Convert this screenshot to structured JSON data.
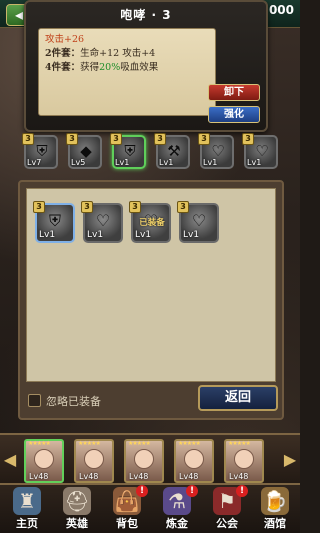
{
  "header": {
    "currency_value": "000"
  },
  "popup": {
    "title": "咆哮 · 3",
    "effects": {
      "attack": "攻击+26",
      "set2_label": "2件套：",
      "set2_text": "生命+12 攻击+4",
      "set4_label": "4件套：",
      "set4_prefix": "获得",
      "set4_pct": "20%",
      "set4_suffix": "吸血效果"
    },
    "buttons": {
      "unequip": "卸下",
      "enhance": "强化"
    }
  },
  "equipped": [
    {
      "badge": "3",
      "icon": "shield-icon",
      "level": "Lv7"
    },
    {
      "badge": "3",
      "icon": "diamond-icon",
      "level": "Lv5"
    },
    {
      "badge": "3",
      "icon": "shield-icon",
      "level": "Lv1"
    },
    {
      "badge": "3",
      "icon": "axe-icon",
      "level": "Lv1"
    },
    {
      "badge": "3",
      "icon": "heart-icon",
      "level": "Lv1"
    },
    {
      "badge": "3",
      "icon": "heart-icon",
      "level": "Lv1"
    }
  ],
  "inventory": [
    {
      "badge": "3",
      "icon": "shield-icon",
      "level": "Lv1",
      "tag": ""
    },
    {
      "badge": "3",
      "icon": "heart-icon",
      "level": "Lv1",
      "tag": ""
    },
    {
      "badge": "3",
      "icon": "heart-icon",
      "level": "Lv1",
      "tag": "已装备"
    },
    {
      "badge": "3",
      "icon": "heart-icon",
      "level": "Lv1",
      "tag": ""
    }
  ],
  "controls": {
    "ignore_equipped_label": "忽略已装备",
    "return_label": "返回"
  },
  "heroes": [
    {
      "stars": "★★★★★",
      "level": "Lv48"
    },
    {
      "stars": "★★★★★",
      "level": "Lv48"
    },
    {
      "stars": "★★★★★",
      "level": "Lv48"
    },
    {
      "stars": "★★★★★",
      "level": "Lv48"
    },
    {
      "stars": "★★★★★",
      "level": "Lv48"
    }
  ],
  "nav": [
    {
      "label": "主页",
      "icon": "castle-icon",
      "alert": ""
    },
    {
      "label": "英雄",
      "icon": "helmet-icon",
      "alert": ""
    },
    {
      "label": "背包",
      "icon": "bag-icon",
      "alert": "!"
    },
    {
      "label": "炼金",
      "icon": "flask-icon",
      "alert": "!"
    },
    {
      "label": "公会",
      "icon": "guild-icon",
      "alert": "!"
    },
    {
      "label": "酒馆",
      "icon": "tavern-icon",
      "alert": ""
    }
  ],
  "colors": {
    "accent_green": "#5fcf5a",
    "attack_red": "#c0411a",
    "pct_green": "#1f8d2a"
  }
}
